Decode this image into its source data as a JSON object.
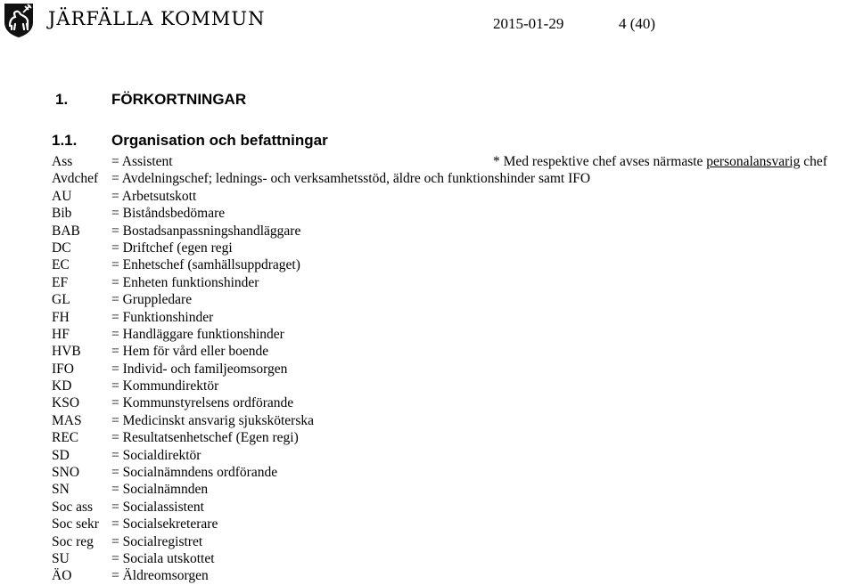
{
  "header": {
    "org_name": "JÄRFÄLLA KOMMUN",
    "logo_icon": "coat-of-arms-shield-icon",
    "date": "2015-01-29",
    "page": "4 (40)"
  },
  "section": {
    "number": "1.",
    "title": "FÖRKORTNINGAR"
  },
  "subsection": {
    "number": "1.1.",
    "title": "Organisation och befattningar"
  },
  "note": {
    "prefix": "* Med respektive chef avses närmaste ",
    "underlined": "personalansvarig",
    "suffix": " chef"
  },
  "abbreviations": [
    {
      "abbr": "Ass",
      "def": "= Assistent"
    },
    {
      "abbr": "Avdchef",
      "def": "= Avdelningschef; lednings- och verksamhetsstöd, äldre och funktionshinder samt IFO"
    },
    {
      "abbr": "AU",
      "def": "= Arbetsutskott"
    },
    {
      "abbr": "Bib",
      "def": "= Biståndsbedömare"
    },
    {
      "abbr": "BAB",
      "def": "= Bostadsanpassningshandläggare"
    },
    {
      "abbr": "DC",
      "def": "= Driftchef (egen regi"
    },
    {
      "abbr": "EC",
      "def": "= Enhetschef (samhällsuppdraget)"
    },
    {
      "abbr": "EF",
      "def": "= Enheten funktionshinder"
    },
    {
      "abbr": "GL",
      "def": "= Gruppledare"
    },
    {
      "abbr": "FH",
      "def": "= Funktionshinder"
    },
    {
      "abbr": "HF",
      "def": "= Handläggare funktionshinder"
    },
    {
      "abbr": "HVB",
      "def": "= Hem för vård eller boende"
    },
    {
      "abbr": "IFO",
      "def": "= Individ- och familjeomsorgen"
    },
    {
      "abbr": "KD",
      "def": "= Kommundirektör"
    },
    {
      "abbr": "KSO",
      "def": "= Kommunstyrelsens ordförande"
    },
    {
      "abbr": "MAS",
      "def": "= Medicinskt ansvarig sjuksköterska"
    },
    {
      "abbr": "REC",
      "def": "= Resultatsenhetschef (Egen regi)"
    },
    {
      "abbr": "SD",
      "def": "= Socialdirektör"
    },
    {
      "abbr": "SNO",
      "def": "= Socialnämndens ordförande"
    },
    {
      "abbr": "SN",
      "def": "= Socialnämnden"
    },
    {
      "abbr": "Soc ass",
      "def": "= Socialassistent"
    },
    {
      "abbr": "Soc sekr",
      "def": "= Socialsekreterare"
    },
    {
      "abbr": "Soc reg",
      "def": "= Socialregistret"
    },
    {
      "abbr": "SU",
      "def": "= Sociala utskottet"
    },
    {
      "abbr": "ÄO",
      "def": "= Äldreomsorgen"
    }
  ]
}
